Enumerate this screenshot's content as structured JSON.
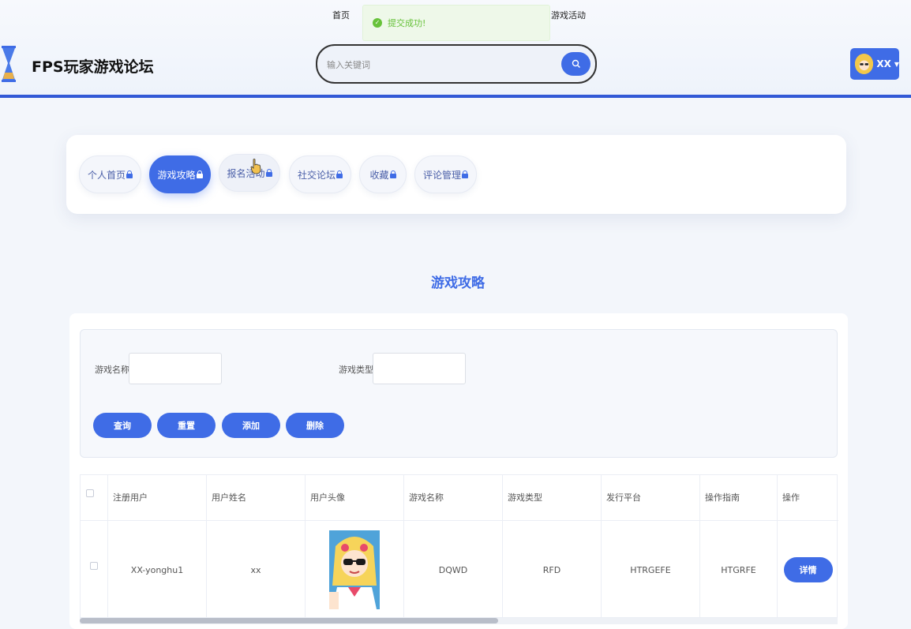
{
  "topnav": {
    "home": "首页",
    "activity": "游戏活动"
  },
  "toast": {
    "message": "提交成功!"
  },
  "header": {
    "site_title": "FPS玩家游戏论坛",
    "search_placeholder": "输入关键词",
    "username": "XX"
  },
  "tabs": [
    {
      "label": "个人首页",
      "active": false
    },
    {
      "label": "游戏攻略",
      "active": true
    },
    {
      "label": "报名活动",
      "active": false
    },
    {
      "label": "社交论坛",
      "active": false
    },
    {
      "label": "收藏",
      "active": false
    },
    {
      "label": "评论管理",
      "active": false
    }
  ],
  "section_title": "游戏攻略",
  "filters": {
    "name_label": "游戏名称",
    "type_label": "游戏类型",
    "buttons": {
      "query": "查询",
      "reset": "重置",
      "add": "添加",
      "delete": "删除"
    }
  },
  "table": {
    "columns": [
      "注册用户",
      "用户姓名",
      "用户头像",
      "游戏名称",
      "游戏类型",
      "发行平台",
      "操作指南",
      "操作"
    ],
    "rows": [
      {
        "username": "XX-yonghu1",
        "name": "xx",
        "game_name": "DQWD",
        "game_type": "RFD",
        "platform": "HTRGEFE",
        "guide": "HTGRFE",
        "action": "详情"
      }
    ]
  },
  "colors": {
    "accent": "#3f6ce6",
    "success": "#67c23a",
    "header_border": "#3259d6"
  }
}
